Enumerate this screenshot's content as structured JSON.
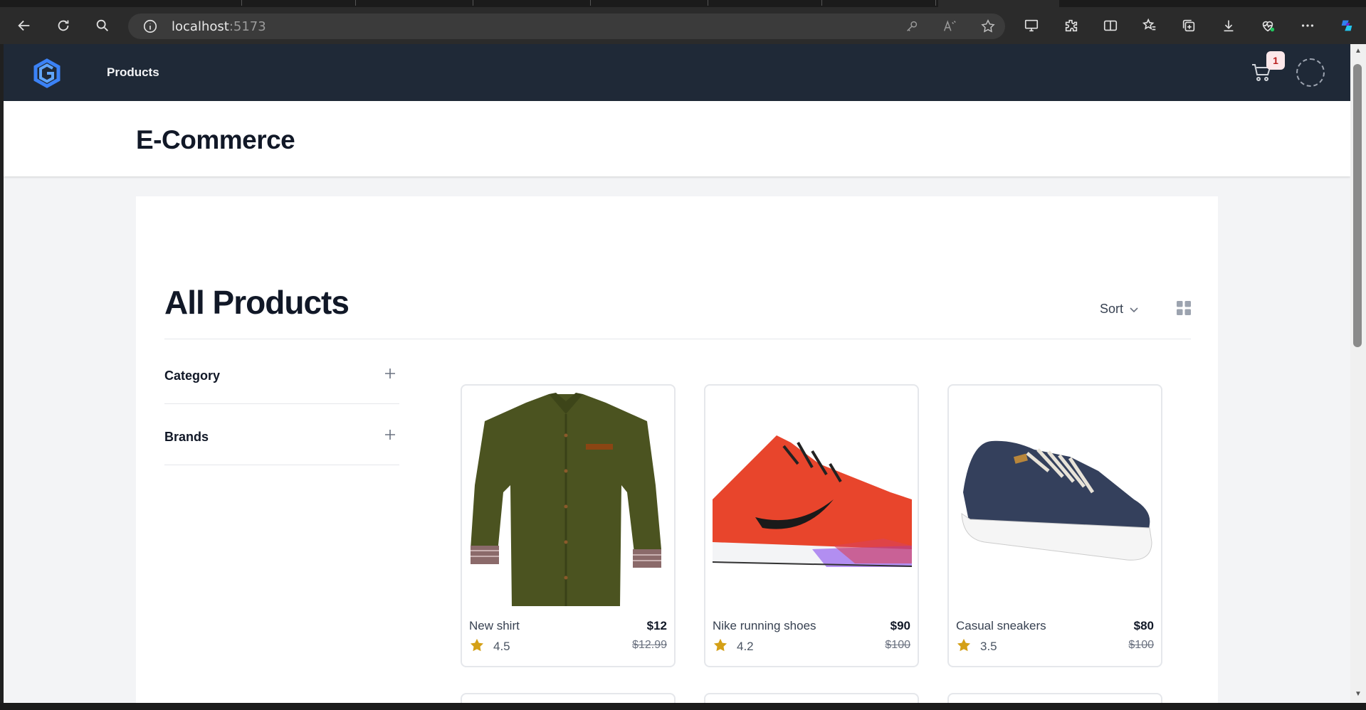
{
  "browser": {
    "url_host": "localhost",
    "url_port": ":5173"
  },
  "navbar": {
    "link": "Products",
    "cart_count": "1"
  },
  "header": {
    "title": "E-Commerce"
  },
  "main": {
    "title": "All Products",
    "sort_label": "Sort"
  },
  "filters": [
    {
      "label": "Category"
    },
    {
      "label": "Brands"
    }
  ],
  "products": [
    {
      "name": "New shirt",
      "price": "$12",
      "old_price": "$12.99",
      "rating": "4.5",
      "image": "shirt"
    },
    {
      "name": "Nike running shoes",
      "price": "$90",
      "old_price": "$100",
      "rating": "4.2",
      "image": "running-shoe"
    },
    {
      "name": "Casual sneakers",
      "price": "$80",
      "old_price": "$100",
      "rating": "3.5",
      "image": "sneaker"
    }
  ],
  "colors": {
    "navbar": "#1f2937",
    "accent": "#2563eb",
    "star": "#d4a017",
    "badge": "#fde8ea"
  }
}
